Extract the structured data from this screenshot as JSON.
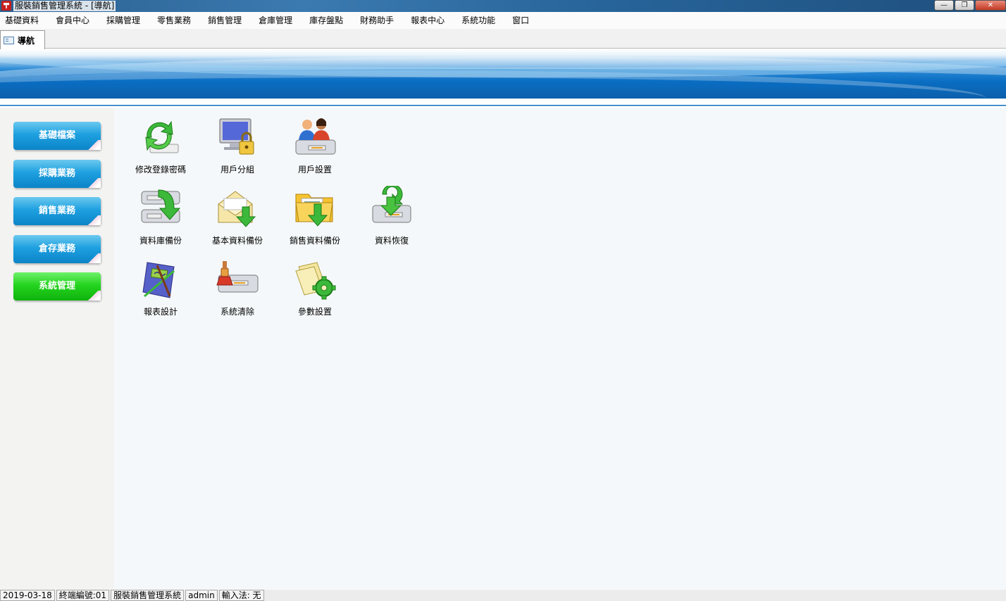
{
  "window": {
    "title": "服裝銷售管理系統 - [導航]"
  },
  "menu": [
    "基礎資料",
    "會員中心",
    "採購管理",
    "零售業務",
    "銷售管理",
    "倉庫管理",
    "庫存盤點",
    "財務助手",
    "報表中心",
    "系統功能",
    "窗口"
  ],
  "tab": {
    "label": "導航"
  },
  "sidebar": {
    "items": [
      {
        "label": "基礎檔案"
      },
      {
        "label": "採購業務"
      },
      {
        "label": "銷售業務"
      },
      {
        "label": "倉存業務"
      },
      {
        "label": "系統管理"
      }
    ],
    "active_color": "#1fcf1a",
    "normal_color": "#1a9ad9"
  },
  "tiles": [
    {
      "label": "修改登錄密碼",
      "icon": "key-refresh-icon"
    },
    {
      "label": "用戶分組",
      "icon": "monitor-lock-icon"
    },
    {
      "label": "用戶設置",
      "icon": "users-drive-icon"
    },
    {
      "label": "資料庫備份",
      "icon": "database-backup-icon"
    },
    {
      "label": "基本資料備份",
      "icon": "mail-backup-icon"
    },
    {
      "label": "銷售資料備份",
      "icon": "folder-backup-icon"
    },
    {
      "label": "資料恢復",
      "icon": "data-restore-icon"
    },
    {
      "label": "報表設計",
      "icon": "report-design-icon"
    },
    {
      "label": "系統清除",
      "icon": "system-clear-icon"
    },
    {
      "label": "參數設置",
      "icon": "settings-gear-icon"
    }
  ],
  "status": {
    "date": "2019-03-18",
    "terminal": "終端編號:01",
    "system": "服裝銷售管理系統",
    "user": "admin",
    "ime": "輸入法: 无"
  }
}
